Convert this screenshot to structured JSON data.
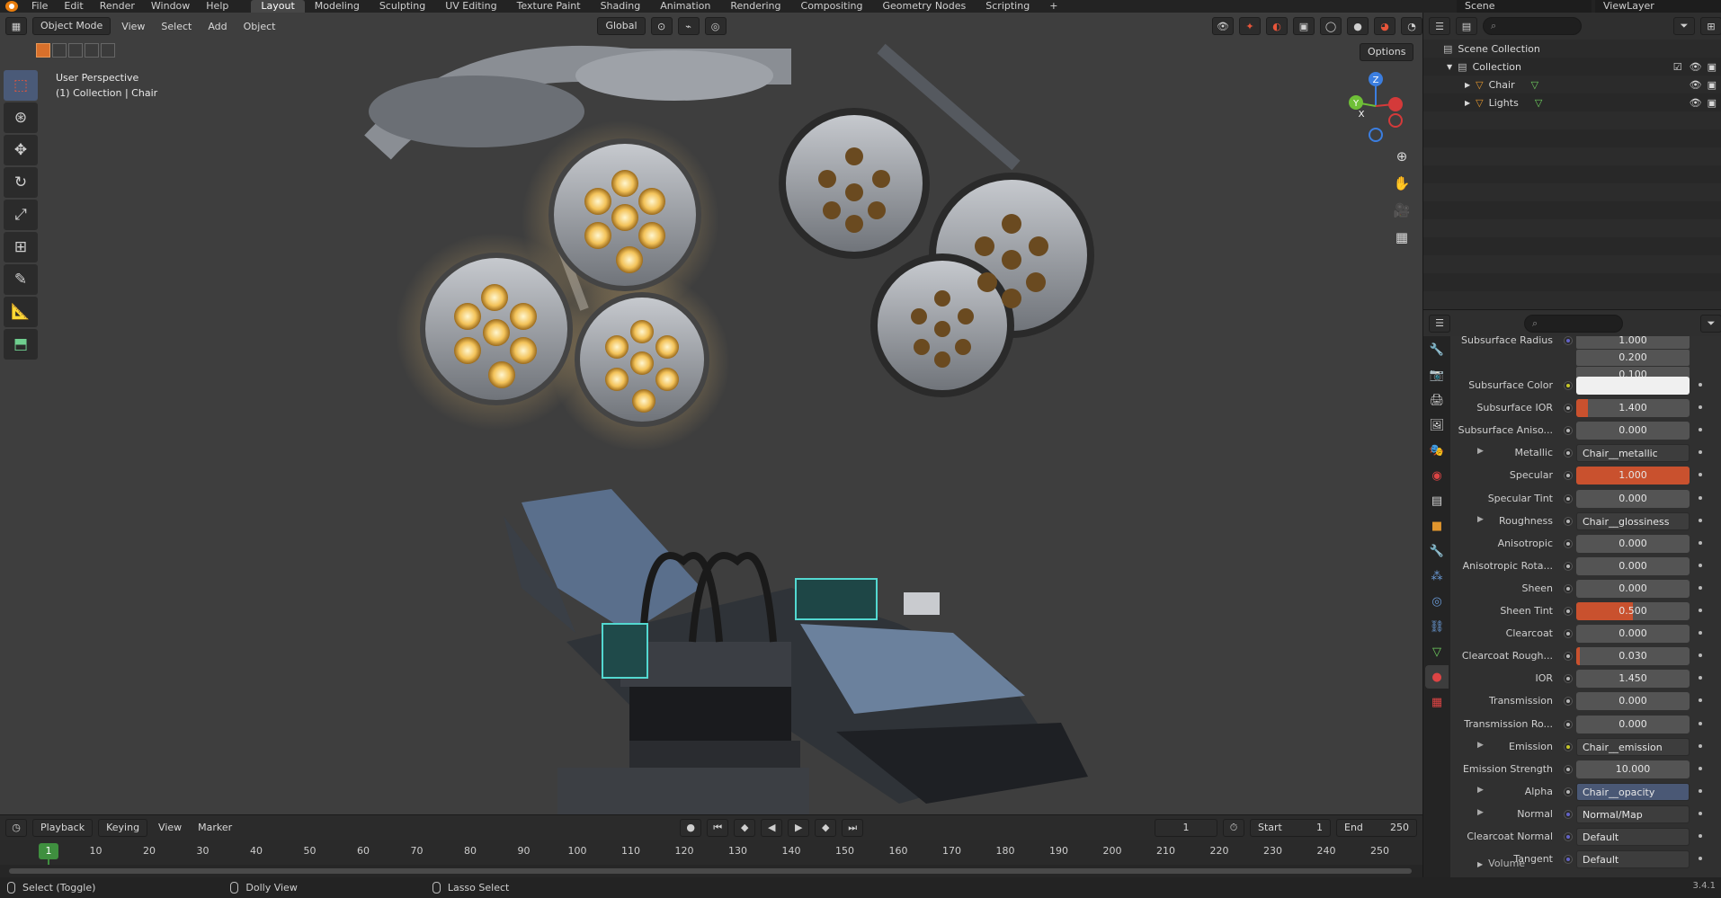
{
  "menu": {
    "items": [
      "File",
      "Edit",
      "Render",
      "Window",
      "Help"
    ],
    "workspaces": [
      "Layout",
      "Modeling",
      "Sculpting",
      "UV Editing",
      "Texture Paint",
      "Shading",
      "Animation",
      "Rendering",
      "Compositing",
      "Geometry Nodes",
      "Scripting"
    ],
    "active_workspace": "Layout",
    "add_tab": "+",
    "scene": "Scene",
    "view_layer": "ViewLayer"
  },
  "viewport_header": {
    "mode": "Object Mode",
    "menus": [
      "View",
      "Select",
      "Add",
      "Object"
    ],
    "orientation": "Global",
    "options": "Options"
  },
  "viewport": {
    "perspective": "User Perspective",
    "collection": "(1) Collection | Chair",
    "gizmo_axes": [
      "X",
      "Y",
      "Z"
    ]
  },
  "toolbar": {
    "tools": [
      "select-box-icon",
      "cursor-icon",
      "move-icon",
      "rotate-icon",
      "scale-icon",
      "transform-icon",
      "annotate-icon",
      "measure-icon",
      "add-cube-icon"
    ]
  },
  "timeline": {
    "menus": [
      "Playback",
      "Keying",
      "View",
      "Marker"
    ],
    "current_frame": "1",
    "start_label": "Start",
    "start": "1",
    "end_label": "End",
    "end": "250",
    "ticks": [
      "10",
      "20",
      "30",
      "40",
      "50",
      "60",
      "70",
      "80",
      "90",
      "100",
      "110",
      "120",
      "130",
      "140",
      "150",
      "160",
      "170",
      "180",
      "190",
      "200",
      "210",
      "220",
      "230",
      "240",
      "250"
    ],
    "marker": "1"
  },
  "statusbar": {
    "items": [
      "Select (Toggle)",
      "Dolly View",
      "Lasso Select"
    ],
    "version": "3.4.1"
  },
  "outliner": {
    "rows": [
      {
        "label": "Scene Collection"
      },
      {
        "label": "Collection"
      },
      {
        "label": "Chair"
      },
      {
        "label": "Lights"
      }
    ]
  },
  "properties": {
    "subsurface_radius_label": "Subsurface Radius",
    "subsurface_radius": [
      "1.000",
      "0.200",
      "0.100"
    ],
    "rows": [
      {
        "label": "Subsurface Color",
        "kind": "color",
        "value": "",
        "socket": "tex"
      },
      {
        "label": "Subsurface IOR",
        "kind": "slider",
        "value": "1.400",
        "fill": 0.1,
        "socket": "grey"
      },
      {
        "label": "Subsurface Aniso...",
        "kind": "slider",
        "value": "0.000",
        "fill": 0,
        "socket": "grey"
      },
      {
        "label": "Metallic",
        "kind": "link",
        "value": "Chair__metallic",
        "socket": "grey",
        "expand": true
      },
      {
        "label": "Specular",
        "kind": "slider",
        "value": "1.000",
        "fill": 1.0,
        "socket": "grey"
      },
      {
        "label": "Specular Tint",
        "kind": "slider",
        "value": "0.000",
        "fill": 0,
        "socket": "grey"
      },
      {
        "label": "Roughness",
        "kind": "link",
        "value": "Chair__glossiness",
        "socket": "grey",
        "expand": true
      },
      {
        "label": "Anisotropic",
        "kind": "slider",
        "value": "0.000",
        "fill": 0,
        "socket": "grey"
      },
      {
        "label": "Anisotropic Rota...",
        "kind": "slider",
        "value": "0.000",
        "fill": 0,
        "socket": "grey"
      },
      {
        "label": "Sheen",
        "kind": "slider",
        "value": "0.000",
        "fill": 0,
        "socket": "grey"
      },
      {
        "label": "Sheen Tint",
        "kind": "slider",
        "value": "0.500",
        "fill": 0.5,
        "socket": "grey"
      },
      {
        "label": "Clearcoat",
        "kind": "slider",
        "value": "0.000",
        "fill": 0,
        "socket": "grey"
      },
      {
        "label": "Clearcoat Rough...",
        "kind": "slider",
        "value": "0.030",
        "fill": 0.03,
        "socket": "grey"
      },
      {
        "label": "IOR",
        "kind": "slider",
        "value": "1.450",
        "fill": 0,
        "socket": "grey"
      },
      {
        "label": "Transmission",
        "kind": "slider",
        "value": "0.000",
        "fill": 0,
        "socket": "grey"
      },
      {
        "label": "Transmission Ro...",
        "kind": "slider",
        "value": "0.000",
        "fill": 0,
        "socket": "grey"
      },
      {
        "label": "Emission",
        "kind": "link",
        "value": "Chair__emission",
        "socket": "tex",
        "expand": true
      },
      {
        "label": "Emission Strength",
        "kind": "slider",
        "value": "10.000",
        "fill": 0,
        "socket": "grey"
      },
      {
        "label": "Alpha",
        "kind": "link",
        "value": "Chair__opacity",
        "socket": "grey",
        "expand": true,
        "highlight": true
      },
      {
        "label": "Normal",
        "kind": "link",
        "value": "Normal/Map",
        "socket": "vec",
        "expand": true
      },
      {
        "label": "Clearcoat Normal",
        "kind": "link",
        "value": "Default",
        "socket": "vec"
      },
      {
        "label": "Tangent",
        "kind": "link",
        "value": "Default",
        "socket": "vec"
      }
    ],
    "volume": "Volume"
  },
  "colors": {
    "accent_orange": "#c9512e",
    "active_blue": "#4a5a78",
    "frame_green": "#3f8f3f",
    "lamp_glow": "#ffb347"
  }
}
